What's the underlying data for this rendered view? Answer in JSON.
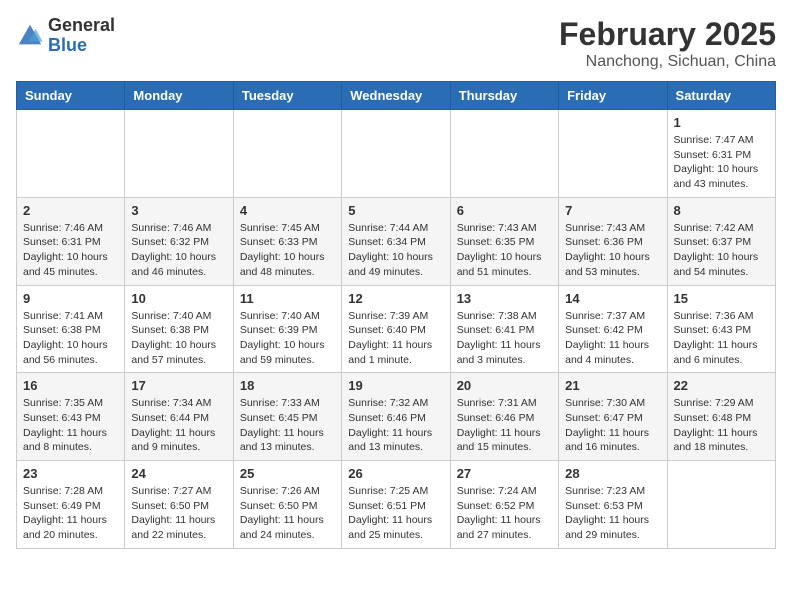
{
  "header": {
    "logo_general": "General",
    "logo_blue": "Blue",
    "month_title": "February 2025",
    "location": "Nanchong, Sichuan, China"
  },
  "weekdays": [
    "Sunday",
    "Monday",
    "Tuesday",
    "Wednesday",
    "Thursday",
    "Friday",
    "Saturday"
  ],
  "weeks": [
    [
      null,
      null,
      null,
      null,
      null,
      null,
      {
        "day": "1",
        "sunrise": "Sunrise: 7:47 AM",
        "sunset": "Sunset: 6:31 PM",
        "daylight": "Daylight: 10 hours and 43 minutes."
      }
    ],
    [
      {
        "day": "2",
        "sunrise": "Sunrise: 7:46 AM",
        "sunset": "Sunset: 6:31 PM",
        "daylight": "Daylight: 10 hours and 45 minutes."
      },
      {
        "day": "3",
        "sunrise": "Sunrise: 7:46 AM",
        "sunset": "Sunset: 6:32 PM",
        "daylight": "Daylight: 10 hours and 46 minutes."
      },
      {
        "day": "4",
        "sunrise": "Sunrise: 7:45 AM",
        "sunset": "Sunset: 6:33 PM",
        "daylight": "Daylight: 10 hours and 48 minutes."
      },
      {
        "day": "5",
        "sunrise": "Sunrise: 7:44 AM",
        "sunset": "Sunset: 6:34 PM",
        "daylight": "Daylight: 10 hours and 49 minutes."
      },
      {
        "day": "6",
        "sunrise": "Sunrise: 7:43 AM",
        "sunset": "Sunset: 6:35 PM",
        "daylight": "Daylight: 10 hours and 51 minutes."
      },
      {
        "day": "7",
        "sunrise": "Sunrise: 7:43 AM",
        "sunset": "Sunset: 6:36 PM",
        "daylight": "Daylight: 10 hours and 53 minutes."
      },
      {
        "day": "8",
        "sunrise": "Sunrise: 7:42 AM",
        "sunset": "Sunset: 6:37 PM",
        "daylight": "Daylight: 10 hours and 54 minutes."
      }
    ],
    [
      {
        "day": "9",
        "sunrise": "Sunrise: 7:41 AM",
        "sunset": "Sunset: 6:38 PM",
        "daylight": "Daylight: 10 hours and 56 minutes."
      },
      {
        "day": "10",
        "sunrise": "Sunrise: 7:40 AM",
        "sunset": "Sunset: 6:38 PM",
        "daylight": "Daylight: 10 hours and 57 minutes."
      },
      {
        "day": "11",
        "sunrise": "Sunrise: 7:40 AM",
        "sunset": "Sunset: 6:39 PM",
        "daylight": "Daylight: 10 hours and 59 minutes."
      },
      {
        "day": "12",
        "sunrise": "Sunrise: 7:39 AM",
        "sunset": "Sunset: 6:40 PM",
        "daylight": "Daylight: 11 hours and 1 minute."
      },
      {
        "day": "13",
        "sunrise": "Sunrise: 7:38 AM",
        "sunset": "Sunset: 6:41 PM",
        "daylight": "Daylight: 11 hours and 3 minutes."
      },
      {
        "day": "14",
        "sunrise": "Sunrise: 7:37 AM",
        "sunset": "Sunset: 6:42 PM",
        "daylight": "Daylight: 11 hours and 4 minutes."
      },
      {
        "day": "15",
        "sunrise": "Sunrise: 7:36 AM",
        "sunset": "Sunset: 6:43 PM",
        "daylight": "Daylight: 11 hours and 6 minutes."
      }
    ],
    [
      {
        "day": "16",
        "sunrise": "Sunrise: 7:35 AM",
        "sunset": "Sunset: 6:43 PM",
        "daylight": "Daylight: 11 hours and 8 minutes."
      },
      {
        "day": "17",
        "sunrise": "Sunrise: 7:34 AM",
        "sunset": "Sunset: 6:44 PM",
        "daylight": "Daylight: 11 hours and 9 minutes."
      },
      {
        "day": "18",
        "sunrise": "Sunrise: 7:33 AM",
        "sunset": "Sunset: 6:45 PM",
        "daylight": "Daylight: 11 hours and 13 minutes."
      },
      {
        "day": "19",
        "sunrise": "Sunrise: 7:32 AM",
        "sunset": "Sunset: 6:46 PM",
        "daylight": "Daylight: 11 hours and 13 minutes."
      },
      {
        "day": "20",
        "sunrise": "Sunrise: 7:31 AM",
        "sunset": "Sunset: 6:46 PM",
        "daylight": "Daylight: 11 hours and 15 minutes."
      },
      {
        "day": "21",
        "sunrise": "Sunrise: 7:30 AM",
        "sunset": "Sunset: 6:47 PM",
        "daylight": "Daylight: 11 hours and 16 minutes."
      },
      {
        "day": "22",
        "sunrise": "Sunrise: 7:29 AM",
        "sunset": "Sunset: 6:48 PM",
        "daylight": "Daylight: 11 hours and 18 minutes."
      }
    ],
    [
      {
        "day": "23",
        "sunrise": "Sunrise: 7:28 AM",
        "sunset": "Sunset: 6:49 PM",
        "daylight": "Daylight: 11 hours and 20 minutes."
      },
      {
        "day": "24",
        "sunrise": "Sunrise: 7:27 AM",
        "sunset": "Sunset: 6:50 PM",
        "daylight": "Daylight: 11 hours and 22 minutes."
      },
      {
        "day": "25",
        "sunrise": "Sunrise: 7:26 AM",
        "sunset": "Sunset: 6:50 PM",
        "daylight": "Daylight: 11 hours and 24 minutes."
      },
      {
        "day": "26",
        "sunrise": "Sunrise: 7:25 AM",
        "sunset": "Sunset: 6:51 PM",
        "daylight": "Daylight: 11 hours and 25 minutes."
      },
      {
        "day": "27",
        "sunrise": "Sunrise: 7:24 AM",
        "sunset": "Sunset: 6:52 PM",
        "daylight": "Daylight: 11 hours and 27 minutes."
      },
      {
        "day": "28",
        "sunrise": "Sunrise: 7:23 AM",
        "sunset": "Sunset: 6:53 PM",
        "daylight": "Daylight: 11 hours and 29 minutes."
      },
      null
    ]
  ]
}
